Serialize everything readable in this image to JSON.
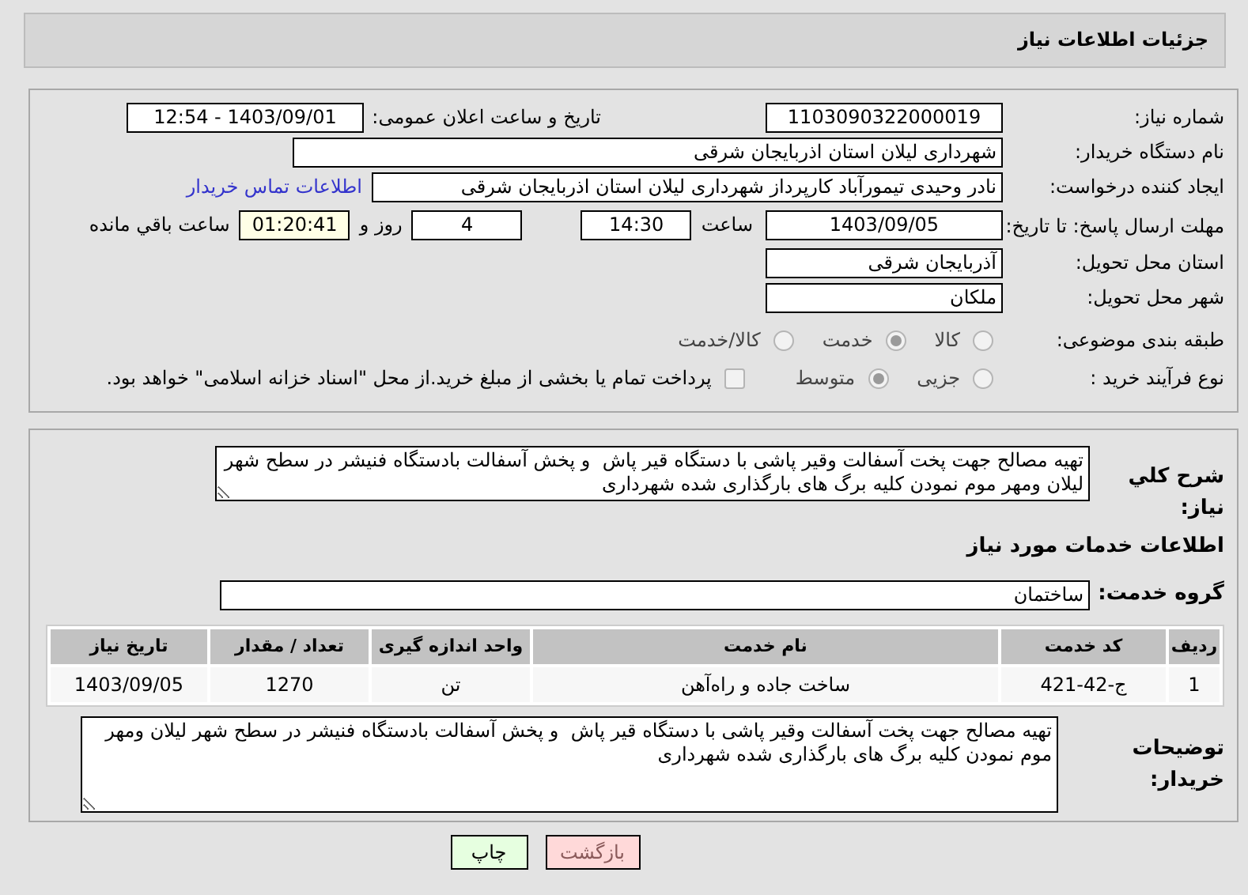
{
  "header": {
    "title": "جزئیات اطلاعات نیاز"
  },
  "need_info": {
    "need_number": {
      "label": "شماره نیاز:",
      "value": "1103090322000019"
    },
    "announce": {
      "label": "تاریخ و ساعت اعلان عمومی:",
      "value": "1403/09/01 - 12:54"
    },
    "buyer_org": {
      "label": "نام دستگاه خریدار:",
      "value": "شهرداری لیلان استان اذربایجان شرقی"
    },
    "requester": {
      "label": "ایجاد کننده درخواست:",
      "value": "نادر وحیدی تیمورآباد کارپرداز شهرداری لیلان استان اذربایجان شرقی"
    },
    "contact_link": "اطلاعات تماس خریدار",
    "deadline": {
      "label": "مهلت ارسال پاسخ: تا تاریخ:",
      "date": "1403/09/05",
      "time_label": "ساعت",
      "time": "14:30",
      "days": "4",
      "days_label": "روز و",
      "remaining": "01:20:41",
      "remaining_label": "ساعت باقي مانده"
    },
    "province": {
      "label": "استان محل تحویل:",
      "value": "آذربایجان شرقی"
    },
    "city": {
      "label": "شهر محل تحویل:",
      "value": "ملکان"
    },
    "category": {
      "label": "طبقه بندی موضوعی:",
      "options": [
        {
          "label": "کالا",
          "selected": false
        },
        {
          "label": "خدمت",
          "selected": true
        },
        {
          "label": "کالا/خدمت",
          "selected": false
        }
      ]
    },
    "process": {
      "label": "نوع فرآیند خرید :",
      "options": [
        {
          "label": "جزیی",
          "selected": false
        },
        {
          "label": "متوسط",
          "selected": true
        }
      ],
      "treasury": {
        "label": "پرداخت تمام یا بخشی از مبلغ خرید.از محل \"اسناد خزانه اسلامی\" خواهد بود.",
        "checked": false
      }
    }
  },
  "details": {
    "description": {
      "label": "شرح کلي نیاز:",
      "value": "تهیه مصالح جهت پخت آسفالت وقیر پاشی با دستگاه قیر پاش  و پخش آسفالت بادستگاه فنیشر در سطح شهر لیلان ومهر موم نمودن کلیه برگ های بارگذاری شده شهرداری"
    },
    "services_heading": "اطلاعات خدمات مورد نیاز",
    "service_group": {
      "label": "گروه خدمت:",
      "value": "ساختمان"
    },
    "table": {
      "columns": [
        "ردیف",
        "کد خدمت",
        "نام خدمت",
        "واحد اندازه گیری",
        "تعداد / مقدار",
        "تاریخ نیاز"
      ],
      "rows": [
        [
          "1",
          "ج-42-421",
          "ساخت جاده و راه‌آهن",
          "تن",
          "1270",
          "1403/09/05"
        ]
      ]
    },
    "buyer_notes": {
      "label": "توضیحات خریدار:",
      "value": "تهیه مصالح جهت پخت آسفالت وقیر پاشی با دستگاه قیر پاش  و پخش آسفالت بادستگاه فنیشر در سطح شهر لیلان ومهر موم نمودن کلیه برگ های بارگذاری شده شهرداری"
    }
  },
  "buttons": [
    {
      "label": "بازگشت",
      "kind": "back"
    },
    {
      "label": "چاپ",
      "kind": "print"
    }
  ]
}
